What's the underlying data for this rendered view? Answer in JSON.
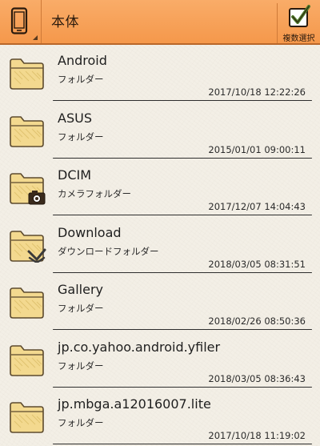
{
  "header": {
    "title": "本体",
    "multi_select_label": "複数選択",
    "device_icon": "smartphone-icon",
    "multi_select_icon": "checkbox-icon",
    "accent_color": "#f7a15a"
  },
  "files": [
    {
      "name": "Android",
      "type": "フォルダー",
      "date": "2017/10/18 12:22:26",
      "badge": null
    },
    {
      "name": "ASUS",
      "type": "フォルダー",
      "date": "2015/01/01 09:00:11",
      "badge": null
    },
    {
      "name": "DCIM",
      "type": "カメラフォルダー",
      "date": "2017/12/07 14:04:43",
      "badge": "camera-icon"
    },
    {
      "name": "Download",
      "type": "ダウンロードフォルダー",
      "date": "2018/03/05 08:31:51",
      "badge": "download-icon"
    },
    {
      "name": "Gallery",
      "type": "フォルダー",
      "date": "2018/02/26 08:50:36",
      "badge": null
    },
    {
      "name": "jp.co.yahoo.android.yfiler",
      "type": "フォルダー",
      "date": "2018/03/05 08:36:43",
      "badge": null
    },
    {
      "name": "jp.mbga.a12016007.lite",
      "type": "フォルダー",
      "date": "2017/10/18 11:19:02",
      "badge": null
    }
  ]
}
